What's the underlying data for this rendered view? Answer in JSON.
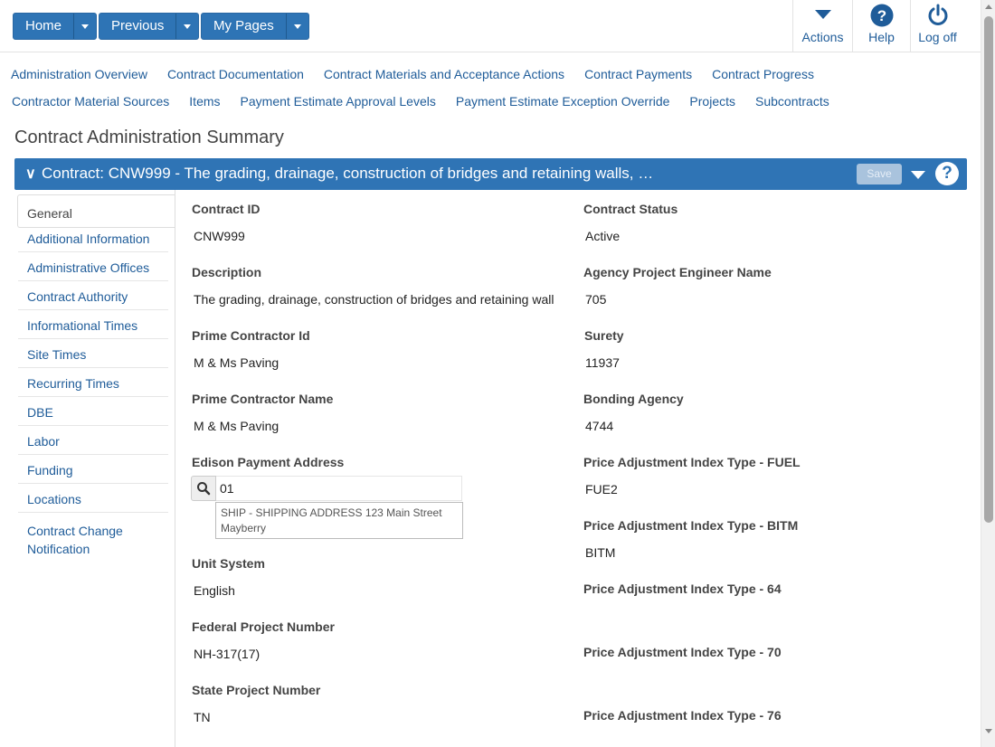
{
  "toolbar": {
    "home_label": "Home",
    "previous_label": "Previous",
    "mypages_label": "My Pages",
    "actions_label": "Actions",
    "help_label": "Help",
    "logoff_label": "Log off"
  },
  "nav": {
    "row1": [
      "Administration Overview",
      "Contract Documentation",
      "Contract Materials and Acceptance Actions",
      "Contract Payments",
      "Contract Progress"
    ],
    "row2": [
      "Contractor Material Sources",
      "Items",
      "Payment Estimate Approval Levels",
      "Payment Estimate Exception Override",
      "Projects",
      "Subcontracts"
    ]
  },
  "page_title": "Contract Administration Summary",
  "banner": {
    "title": "Contract: CNW999 - The grading, drainage, construction of bridges and retaining walls, …",
    "save_label": "Save"
  },
  "sidebar": {
    "items": [
      "General",
      "Additional Information",
      "Administrative Offices",
      "Contract Authority",
      "Informational Times",
      "Site Times",
      "Recurring Times",
      "DBE",
      "Labor",
      "Funding",
      "Locations",
      "Contract Change Notification"
    ]
  },
  "fields": {
    "contract_id": {
      "label": "Contract ID",
      "value": "CNW999"
    },
    "description": {
      "label": "Description",
      "value": "The grading, drainage, construction of bridges and retaining wall"
    },
    "prime_contractor_id": {
      "label": "Prime Contractor Id",
      "value": "M & Ms Paving"
    },
    "prime_contractor_name": {
      "label": "Prime Contractor Name",
      "value": "M & Ms Paving"
    },
    "edison_payment_address": {
      "label": "Edison Payment Address",
      "value": "01",
      "suggestion_line1": "SHIP - SHIPPING ADDRESS 123 Main Street",
      "suggestion_line2": "Mayberry"
    },
    "unit_system": {
      "label": "Unit System",
      "value": "English"
    },
    "federal_project_number": {
      "label": "Federal Project Number",
      "value": "NH-317(17)"
    },
    "state_project_number": {
      "label": "State Project Number",
      "value": "TN"
    },
    "contract_status": {
      "label": "Contract Status",
      "value": "Active"
    },
    "agency_project_engineer": {
      "label": "Agency Project Engineer Name",
      "value": "705"
    },
    "surety": {
      "label": "Surety",
      "value": "11937"
    },
    "bonding_agency": {
      "label": "Bonding Agency",
      "value": "4744"
    },
    "pai_fuel": {
      "label": "Price Adjustment Index Type - FUEL",
      "value": "FUE2"
    },
    "pai_bitm": {
      "label": "Price Adjustment Index Type - BITM",
      "value": "BITM"
    },
    "pai_64": {
      "label": "Price Adjustment Index Type - 64",
      "value": ""
    },
    "pai_70": {
      "label": "Price Adjustment Index Type - 70",
      "value": ""
    },
    "pai_76": {
      "label": "Price Adjustment Index Type - 76",
      "value": ""
    }
  },
  "colors": {
    "accent": "#2f74b5",
    "link": "#1f5c99"
  }
}
